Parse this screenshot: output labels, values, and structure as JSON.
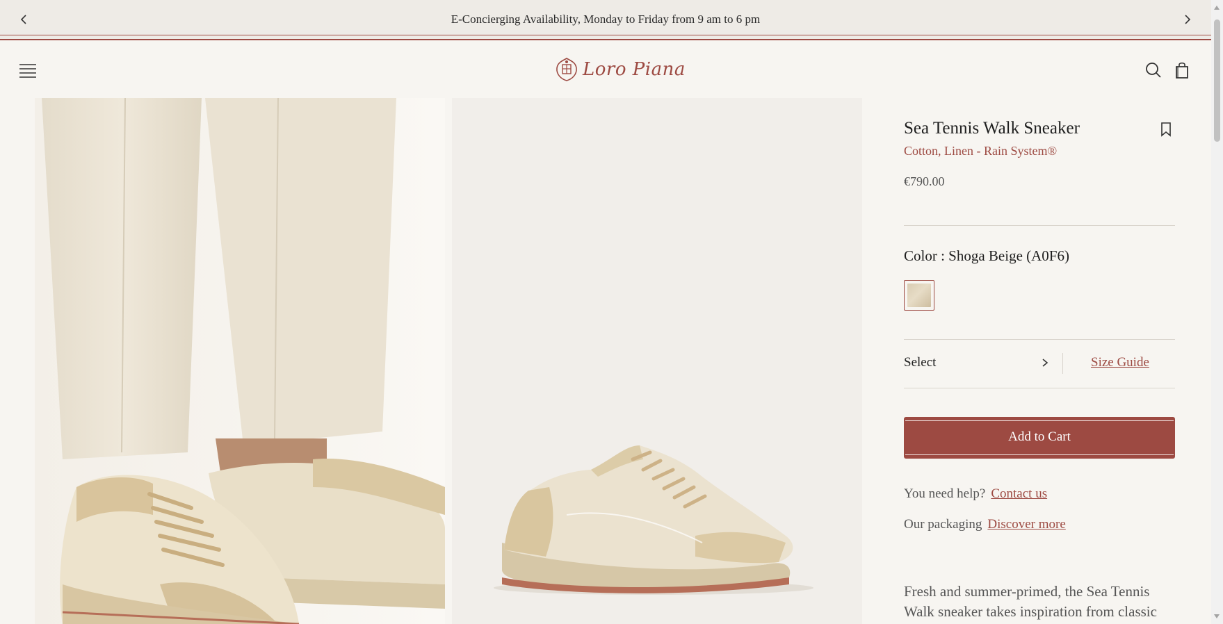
{
  "announcement": {
    "text": "E-Concierging Availability, Monday to Friday from 9 am to 6 pm",
    "prev_icon": "chevron-left-icon",
    "next_icon": "chevron-right-icon"
  },
  "header": {
    "brand": "Loro Piana",
    "menu_icon": "hamburger-menu-icon",
    "search_icon": "search-icon",
    "bag_icon": "shopping-bag-icon"
  },
  "product": {
    "name": "Sea Tennis Walk Sneaker",
    "material": "Cotton, Linen - Rain System®",
    "price": "€790.00",
    "color_label": "Color : Shoga Beige (A0F6)",
    "size_select_label": "Select",
    "size_guide_label": "Size Guide",
    "add_to_cart_label": "Add to Cart",
    "help_text": "You need help?",
    "help_link": "Contact us",
    "packaging_text": "Our packaging",
    "packaging_link": "Discover more",
    "description": "Fresh and summer-primed, the Sea Tennis Walk sneaker takes inspiration from classic"
  },
  "colors": {
    "accent": "#9d4a42",
    "background": "#f7f5f1",
    "announcement_bg": "#eeebe6"
  }
}
